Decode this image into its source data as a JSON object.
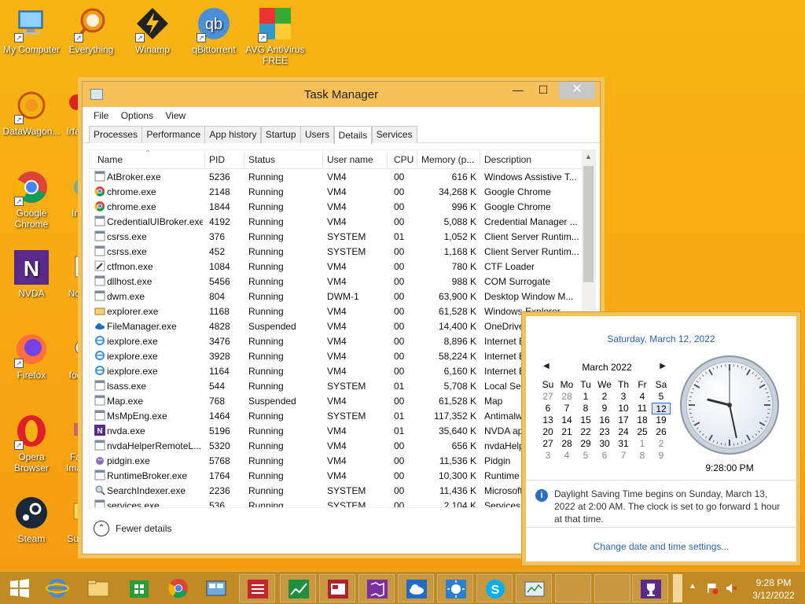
{
  "desktop": {
    "icons": [
      {
        "label": "My Computer"
      },
      {
        "label": "Everything"
      },
      {
        "label": "Winamp"
      },
      {
        "label": "qBittorrent"
      },
      {
        "label": "AVG AntiVirus FREE"
      },
      {
        "label": "DataWagon..."
      },
      {
        "label": "Irfa"
      },
      {
        "label": "Google Chrome"
      },
      {
        "label": "In"
      },
      {
        "label": "NVDA"
      },
      {
        "label": "Not"
      },
      {
        "label": "Firefox"
      },
      {
        "label": "foo"
      },
      {
        "label": "Opera Browser"
      },
      {
        "label": "Fa Imag"
      },
      {
        "label": "Steam"
      },
      {
        "label": "Sun"
      }
    ]
  },
  "taskmanager": {
    "title": "Task Manager",
    "menu": [
      "File",
      "Options",
      "View"
    ],
    "tabs": [
      "Processes",
      "Performance",
      "App history",
      "Startup",
      "Users",
      "Details",
      "Services"
    ],
    "active_tab": "Details",
    "columns": [
      "Name",
      "PID",
      "Status",
      "User name",
      "CPU",
      "Memory (p...",
      "Description"
    ],
    "rows": [
      {
        "name": "AtBroker.exe",
        "pid": "5236",
        "status": "Running",
        "user": "VM4",
        "cpu": "00",
        "mem": "616 K",
        "desc": "Windows Assistive T...",
        "icon": "generic-window"
      },
      {
        "name": "chrome.exe",
        "pid": "2148",
        "status": "Running",
        "user": "VM4",
        "cpu": "00",
        "mem": "34,268 K",
        "desc": "Google Chrome",
        "icon": "chrome"
      },
      {
        "name": "chrome.exe",
        "pid": "1844",
        "status": "Running",
        "user": "VM4",
        "cpu": "00",
        "mem": "996 K",
        "desc": "Google Chrome",
        "icon": "chrome"
      },
      {
        "name": "CredentialUIBroker.exe",
        "pid": "4192",
        "status": "Running",
        "user": "VM4",
        "cpu": "00",
        "mem": "5,088 K",
        "desc": "Credential Manager ...",
        "icon": "generic-window"
      },
      {
        "name": "csrss.exe",
        "pid": "376",
        "status": "Running",
        "user": "SYSTEM",
        "cpu": "01",
        "mem": "1,052 K",
        "desc": "Client Server Runtim...",
        "icon": "generic-window"
      },
      {
        "name": "csrss.exe",
        "pid": "452",
        "status": "Running",
        "user": "SYSTEM",
        "cpu": "00",
        "mem": "1,168 K",
        "desc": "Client Server Runtim...",
        "icon": "generic-window"
      },
      {
        "name": "ctfmon.exe",
        "pid": "1084",
        "status": "Running",
        "user": "VM4",
        "cpu": "00",
        "mem": "780 K",
        "desc": "CTF Loader",
        "icon": "pen"
      },
      {
        "name": "dllhost.exe",
        "pid": "5456",
        "status": "Running",
        "user": "VM4",
        "cpu": "00",
        "mem": "988 K",
        "desc": "COM Surrogate",
        "icon": "generic-window"
      },
      {
        "name": "dwm.exe",
        "pid": "804",
        "status": "Running",
        "user": "DWM-1",
        "cpu": "00",
        "mem": "63,900 K",
        "desc": "Desktop Window M...",
        "icon": "generic-window"
      },
      {
        "name": "explorer.exe",
        "pid": "1168",
        "status": "Running",
        "user": "VM4",
        "cpu": "00",
        "mem": "61,528 K",
        "desc": "Windows Explorer",
        "icon": "folder"
      },
      {
        "name": "FileManager.exe",
        "pid": "4828",
        "status": "Suspended",
        "user": "VM4",
        "cpu": "00",
        "mem": "14,400 K",
        "desc": "OneDrive",
        "icon": "onedrive"
      },
      {
        "name": "iexplore.exe",
        "pid": "3476",
        "status": "Running",
        "user": "VM4",
        "cpu": "00",
        "mem": "8,896 K",
        "desc": "Internet E",
        "icon": "ie"
      },
      {
        "name": "iexplore.exe",
        "pid": "3928",
        "status": "Running",
        "user": "VM4",
        "cpu": "00",
        "mem": "58,224 K",
        "desc": "Internet E",
        "icon": "ie"
      },
      {
        "name": "iexplore.exe",
        "pid": "1164",
        "status": "Running",
        "user": "VM4",
        "cpu": "00",
        "mem": "6,160 K",
        "desc": "Internet E",
        "icon": "ie"
      },
      {
        "name": "lsass.exe",
        "pid": "544",
        "status": "Running",
        "user": "SYSTEM",
        "cpu": "01",
        "mem": "5,708 K",
        "desc": "Local Sec",
        "icon": "generic-window"
      },
      {
        "name": "Map.exe",
        "pid": "768",
        "status": "Suspended",
        "user": "VM4",
        "cpu": "00",
        "mem": "61,528 K",
        "desc": "Map",
        "icon": "generic-window"
      },
      {
        "name": "MsMpEng.exe",
        "pid": "1464",
        "status": "Running",
        "user": "SYSTEM",
        "cpu": "01",
        "mem": "117,352 K",
        "desc": "Antimalw",
        "icon": "generic-window"
      },
      {
        "name": "nvda.exe",
        "pid": "5196",
        "status": "Running",
        "user": "VM4",
        "cpu": "01",
        "mem": "35,640 K",
        "desc": "NVDA app",
        "icon": "nvda"
      },
      {
        "name": "nvdaHelperRemoteL...",
        "pid": "5320",
        "status": "Running",
        "user": "VM4",
        "cpu": "00",
        "mem": "656 K",
        "desc": "nvdaHelp",
        "icon": "generic-window"
      },
      {
        "name": "pidgin.exe",
        "pid": "5768",
        "status": "Running",
        "user": "VM4",
        "cpu": "00",
        "mem": "11,536 K",
        "desc": "Pidgin",
        "icon": "pidgin"
      },
      {
        "name": "RuntimeBroker.exe",
        "pid": "1764",
        "status": "Running",
        "user": "VM4",
        "cpu": "00",
        "mem": "10,300 K",
        "desc": "Runtime I",
        "icon": "generic-window"
      },
      {
        "name": "SearchIndexer.exe",
        "pid": "2236",
        "status": "Running",
        "user": "SYSTEM",
        "cpu": "00",
        "mem": "11,436 K",
        "desc": "Microsoft",
        "icon": "search-indexer"
      },
      {
        "name": "services.exe",
        "pid": "536",
        "status": "Running",
        "user": "SYSTEM",
        "cpu": "00",
        "mem": "2,104 K",
        "desc": "Services a",
        "icon": "generic-window"
      }
    ],
    "fewer_details": "Fewer details"
  },
  "flyout": {
    "long_date": "Saturday, March 12, 2022",
    "month_label": "March 2022",
    "weekdays": [
      "Su",
      "Mo",
      "Tu",
      "We",
      "Th",
      "Fr",
      "Sa"
    ],
    "weeks": [
      [
        "27",
        "28",
        "1",
        "2",
        "3",
        "4",
        "5"
      ],
      [
        "6",
        "7",
        "8",
        "9",
        "10",
        "11",
        "12"
      ],
      [
        "13",
        "14",
        "15",
        "16",
        "17",
        "18",
        "19"
      ],
      [
        "20",
        "21",
        "22",
        "23",
        "24",
        "25",
        "26"
      ],
      [
        "27",
        "28",
        "29",
        "30",
        "31",
        "1",
        "2"
      ],
      [
        "3",
        "4",
        "5",
        "6",
        "7",
        "8",
        "9"
      ]
    ],
    "today": "12",
    "digital_time": "9:28:00 PM",
    "dst_notice": "Daylight Saving Time begins on Sunday, March 13, 2022 at 2:00 AM. The clock is set to go forward 1 hour at that time.",
    "change_link": "Change date and time settings...",
    "clock_hours": 9,
    "clock_minutes": 28
  },
  "taskbar": {
    "time": "9:28 PM",
    "date": "3/12/2022",
    "apps": [
      "start-button",
      "internet-explorer",
      "file-explorer",
      "store",
      "chrome",
      "control-panel",
      "app-red",
      "app-green",
      "app-news",
      "app-purple-map",
      "onedrive",
      "app-weather",
      "skype",
      "task-manager",
      "blank",
      "app-trophy"
    ]
  },
  "colors": {
    "desktop": "#f6b413",
    "accent_link": "#2763b5",
    "taskbar": "#c08a25"
  }
}
